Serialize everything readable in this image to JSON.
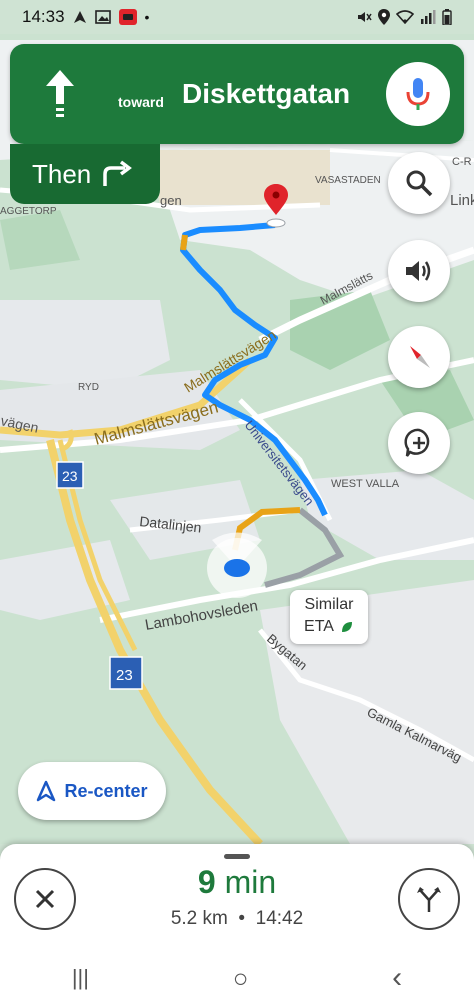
{
  "status_bar": {
    "time": "14:33",
    "icons_left": [
      "navigation-icon",
      "image-icon",
      "car-icon",
      "dot-icon"
    ],
    "icons_right": [
      "mute-icon",
      "location-icon",
      "wifi-icon",
      "signal-icon",
      "battery-icon"
    ]
  },
  "navigation": {
    "direction_icon": "straight-arrow-icon",
    "toward_label": "toward",
    "street": "Diskettgatan",
    "then_label": "Then",
    "then_icon": "turn-right-icon",
    "mic_icon": "microphone-icon"
  },
  "map_labels": {
    "vasastaden": "VASASTADEN",
    "c_r": "C-R",
    "link": "Link",
    "aggetorp": "AGGETORP",
    "gen": "gen",
    "malmslatts1": "Malmslätts",
    "malmslattsvagen1": "Malmslättsvägen",
    "ryd": "RYD",
    "vagen": "vägen",
    "malmslattsvagen2": "Malmslättsvägen",
    "universitetsvagen": "Universitetsvägen",
    "west_valla": "WEST VALLA",
    "road23a": "23",
    "road23b": "23",
    "datalinjen": "Datalinjen",
    "lambohovsleden": "Lambohovsleden",
    "bygatan": "Bygatan",
    "gamla_kalmarvagen": "Gamla Kalmarväg"
  },
  "map_buttons": {
    "search_icon": "search-icon",
    "sound_icon": "volume-icon",
    "compass_icon": "compass-icon",
    "report_icon": "add-report-icon"
  },
  "eta_bubble": {
    "line1": "Similar",
    "line2": "ETA",
    "icon": "leaf-icon"
  },
  "recenter": {
    "label": "Re-center",
    "icon": "navigation-arrow-icon"
  },
  "trip": {
    "time_value": "9",
    "time_unit": "min",
    "distance": "5.2 km",
    "separator": "•",
    "arrival": "14:42",
    "close_icon": "close-icon",
    "routes_icon": "alternate-routes-icon"
  },
  "system_nav": {
    "recents": "|||",
    "home": "○",
    "back": "‹"
  },
  "colors": {
    "nav_green": "#1e7a3c",
    "route_blue": "#1a8cff",
    "traffic_orange": "#e8a317",
    "highway_yellow": "#f2d26b"
  }
}
